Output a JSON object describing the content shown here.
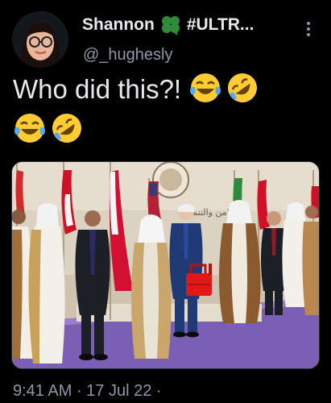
{
  "tweet": {
    "display_name": "Shannon",
    "name_suffix": "#ULTR...",
    "handle": "@_hughesly",
    "text": "Who did this?!",
    "emojis": [
      "face-with-tears-of-joy",
      "rolling-on-floor-laughing",
      "face-with-tears-of-joy",
      "rolling-on-floor-laughing"
    ],
    "timestamp": "9:41 AM · 17 Jul 22 ·"
  },
  "media": {
    "banner_text": "اللامن والتنمية"
  },
  "colors": {
    "background": "#000000",
    "primary_text": "#e7e9ea",
    "secondary_text": "#8b98a5",
    "clover_green": "#2e8b3a",
    "carpet_purple": "#7b5fb5"
  },
  "icons": {
    "clover": "four-leaf-clover-icon",
    "more": "more-options-icon"
  }
}
